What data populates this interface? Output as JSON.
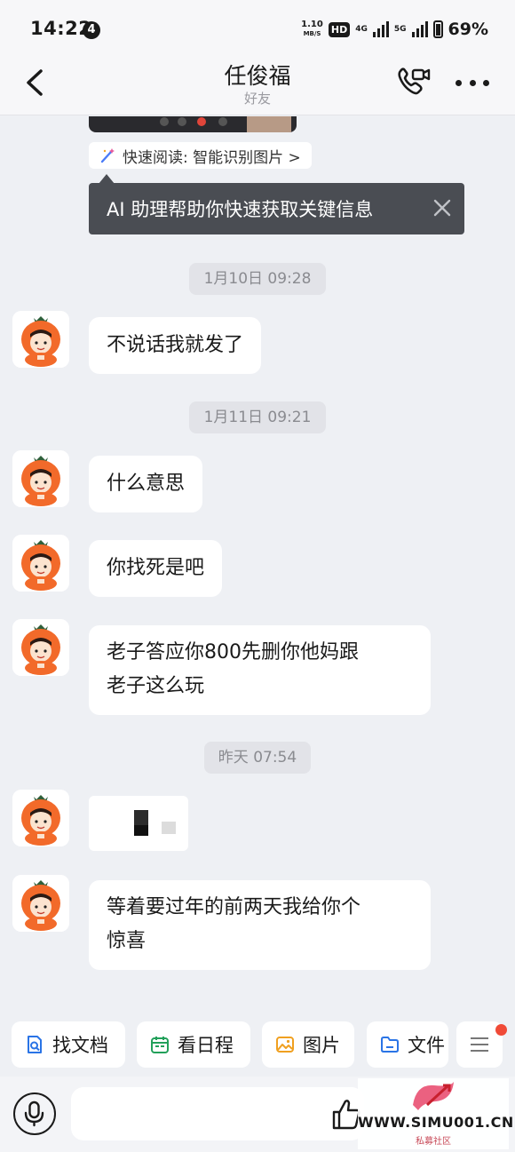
{
  "status_bar": {
    "time": "14:22",
    "notification_count": "4",
    "speed_value": "1.10",
    "speed_unit": "MB/S",
    "hd": "HD",
    "net1": "4G",
    "net2": "5G",
    "battery": "69%"
  },
  "header": {
    "title": "任俊福",
    "subtitle": "好友",
    "icons": [
      "back-icon",
      "video-call-icon",
      "more-icon"
    ]
  },
  "quick_read": {
    "label": "快速阅读: 智能识别图片 >"
  },
  "tooltip": {
    "text": "AI 助理帮助你快速获取关键信息"
  },
  "messages": {
    "ts1": "1月10日 09:28",
    "m1": "不说话我就发了",
    "ts2": "1月11日 09:21",
    "m2": "什么意思",
    "m3": "你找死是吧",
    "m4a": "老子答应你800先删你他妈跟",
    "m4b": "老子这么玩",
    "ts3": "昨天 07:54",
    "m6a": "等着要过年的前两天我给你个",
    "m6b": "惊喜"
  },
  "shortcuts": {
    "docs": "找文档",
    "schedule": "看日程",
    "image": "图片",
    "file": "文件"
  },
  "input": {
    "placeholder": ""
  },
  "watermark": {
    "url": "WWW.SIMU001.CN",
    "sub": "私募社区"
  },
  "colors": {
    "accent_red": "#f04a37",
    "tooltip_bg": "#4a4d53",
    "avatar_orange": "#f26a2a",
    "leaf_green": "#2f5f3a"
  }
}
